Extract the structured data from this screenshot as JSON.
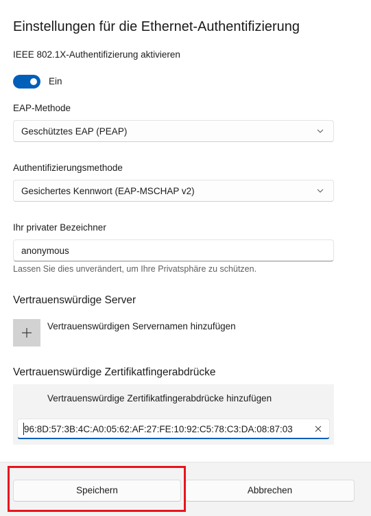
{
  "dialog": {
    "title": "Einstellungen für die Ethernet-Authentifizierung"
  },
  "ieee": {
    "label": "IEEE 802.1X-Authentifizierung aktivieren",
    "toggle_state": "Ein",
    "enabled": true
  },
  "eap": {
    "label": "EAP-Methode",
    "value": "Geschütztes EAP (PEAP)"
  },
  "auth": {
    "label": "Authentifizierungsmethode",
    "value": "Gesichertes Kennwort (EAP-MSCHAP v2)"
  },
  "identity": {
    "label": "Ihr privater Bezeichner",
    "value": "anonymous",
    "hint": "Lassen Sie dies unverändert, um Ihre Privatsphäre zu schützen."
  },
  "servers": {
    "heading": "Vertrauenswürdige Server",
    "add_label": "Vertrauenswürdigen Servernamen hinzufügen"
  },
  "fingerprints": {
    "heading": "Vertrauenswürdige Zertifikatfingerabdrücke",
    "add_label": "Vertrauenswürdige Zertifikatfingerabdrücke hinzufügen",
    "value": "96:8D:57:3B:4C:A0:05:62:AF:27:FE:10:92:C5:78:C3:DA:08:87:03"
  },
  "footer": {
    "save_label": "Speichern",
    "cancel_label": "Abbrechen"
  },
  "colors": {
    "accent": "#005fb8",
    "highlight": "#e8141d"
  }
}
